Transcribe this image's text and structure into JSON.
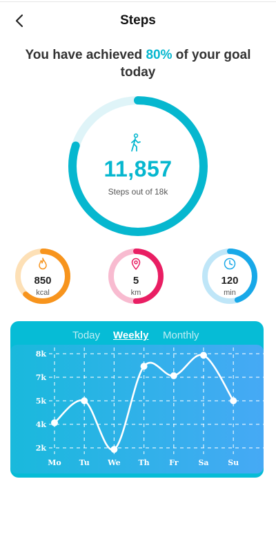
{
  "header": {
    "title": "Steps",
    "back_icon": "chevron-left-icon"
  },
  "achievement": {
    "prefix": "You have achieved ",
    "percent": "80%",
    "suffix": " of your goal today"
  },
  "main": {
    "steps": "11,857",
    "subtitle": "Steps out of 18k",
    "progress": 0.8,
    "icon": "walking-person-icon"
  },
  "stats": [
    {
      "value": "850",
      "unit": "kcal",
      "icon": "flame-icon",
      "color": "#f7941d",
      "track": "#fde0b6",
      "progress": 0.62
    },
    {
      "value": "5",
      "unit": "km",
      "icon": "location-pin-icon",
      "color": "#e91e63",
      "track": "#f8bbd0",
      "progress": 0.5
    },
    {
      "value": "120",
      "unit": "min",
      "icon": "clock-icon",
      "color": "#18a8e8",
      "track": "#bfe6f8",
      "progress": 0.45
    }
  ],
  "colors": {
    "accent": "#06b7cf",
    "card": "#06bcd6"
  },
  "tabs": [
    "Today",
    "Weekly",
    "Monthly"
  ],
  "active_tab": "Weekly",
  "chart_data": {
    "type": "line",
    "categories": [
      "Mo",
      "Tu",
      "We",
      "Th",
      "Fr",
      "Sa",
      "Su"
    ],
    "values": [
      3.6,
      5.0,
      1.9,
      7.2,
      6.6,
      7.9,
      5.0
    ],
    "ytick_labels": [
      "2k",
      "4k",
      "5k",
      "7k",
      "8k"
    ],
    "ylim": [
      2,
      8
    ],
    "grid": true
  }
}
